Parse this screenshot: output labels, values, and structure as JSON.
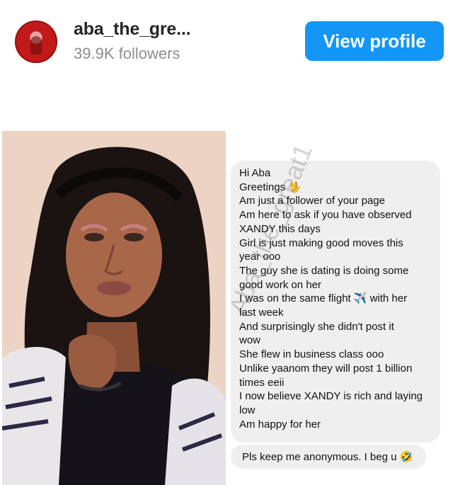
{
  "header": {
    "username": "aba_the_gre...",
    "followers": "39.9K followers",
    "view_profile_label": "View profile"
  },
  "dm": {
    "lines": [
      "Hi Aba",
      "Greetings 🖖",
      "Am just a follower of your page",
      "Am here to ask if you have observed",
      "XANDY this days",
      "Girl is just making good moves this",
      "year ooo",
      "The guy she is dating is doing some",
      "good work on her",
      "I was on the same flight ✈️ with her",
      "last week",
      "And surprisingly she didn't post it",
      "wow",
      "She flew in business class ooo",
      "Unlike yaanom they will post 1 billion",
      "times eeii",
      "I now believe XANDY is rich and laying",
      "low",
      "Am happy for her"
    ],
    "second_message": "Pls keep me anonymous. I beg u 🤣",
    "watermark": "Aba_the_great1"
  },
  "colors": {
    "button": "#1496f6",
    "bubble": "#efefef",
    "avatar": "#c21a1a"
  }
}
